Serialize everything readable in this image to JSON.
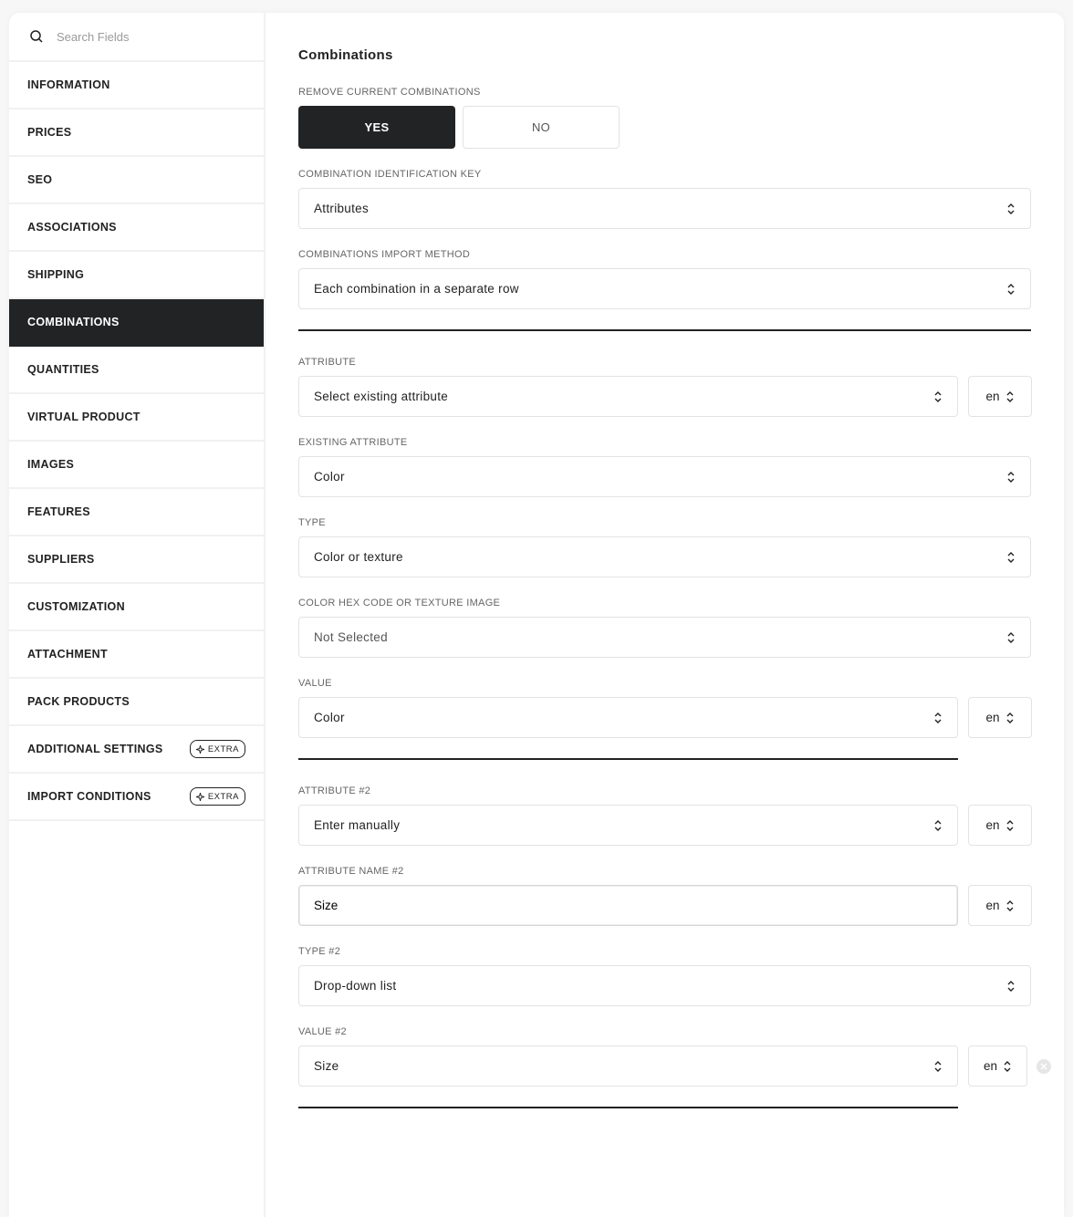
{
  "sidebar": {
    "search_placeholder": "Search Fields",
    "items": [
      {
        "label": "INFORMATION"
      },
      {
        "label": "PRICES"
      },
      {
        "label": "SEO"
      },
      {
        "label": "ASSOCIATIONS"
      },
      {
        "label": "SHIPPING"
      },
      {
        "label": "COMBINATIONS",
        "active": true
      },
      {
        "label": "QUANTITIES"
      },
      {
        "label": "VIRTUAL PRODUCT"
      },
      {
        "label": "IMAGES"
      },
      {
        "label": "FEATURES"
      },
      {
        "label": "SUPPLIERS"
      },
      {
        "label": "CUSTOMIZATION"
      },
      {
        "label": "ATTACHMENT"
      },
      {
        "label": "PACK PRODUCTS"
      },
      {
        "label": "ADDITIONAL SETTINGS",
        "badge": "EXTRA"
      },
      {
        "label": "IMPORT CONDITIONS",
        "badge": "EXTRA"
      }
    ]
  },
  "main": {
    "title": "Combinations",
    "remove_current": {
      "label": "REMOVE CURRENT COMBINATIONS",
      "yes": "YES",
      "no": "NO",
      "selected": "YES"
    },
    "id_key": {
      "label": "COMBINATION IDENTIFICATION KEY",
      "value": "Attributes"
    },
    "import_method": {
      "label": "COMBINATIONS IMPORT METHOD",
      "value": "Each combination in a separate row"
    },
    "attribute": {
      "label": "ATTRIBUTE",
      "value": "Select existing attribute",
      "lang": "en"
    },
    "existing_attribute": {
      "label": "EXISTING ATTRIBUTE",
      "value": "Color"
    },
    "type": {
      "label": "TYPE",
      "value": "Color or texture"
    },
    "color_hex": {
      "label": "COLOR HEX CODE OR TEXTURE IMAGE",
      "value": "Not Selected"
    },
    "value": {
      "label": "VALUE",
      "value": "Color",
      "lang": "en"
    },
    "attribute2": {
      "label": "ATTRIBUTE #2",
      "value": "Enter manually",
      "lang": "en"
    },
    "attribute_name2": {
      "label": "ATTRIBUTE NAME #2",
      "value": "Size",
      "lang": "en"
    },
    "type2": {
      "label": "TYPE #2",
      "value": "Drop-down list"
    },
    "value2": {
      "label": "VALUE #2",
      "value": "Size",
      "lang": "en"
    }
  }
}
